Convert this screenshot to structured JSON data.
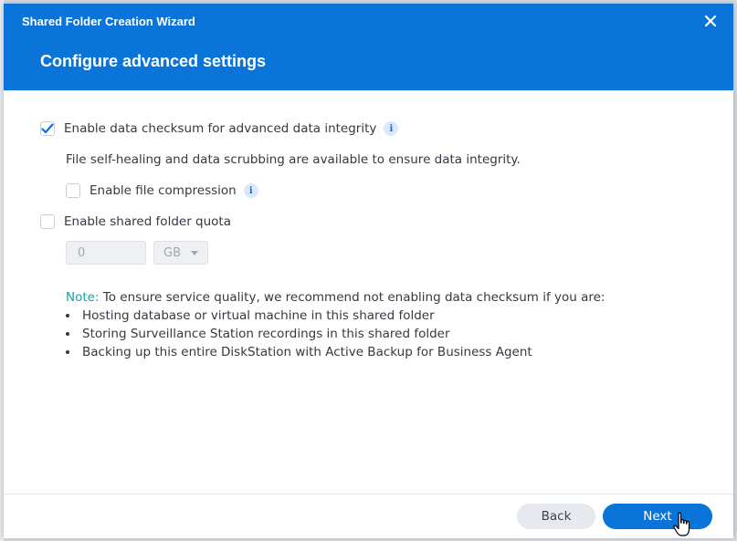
{
  "window": {
    "title": "Shared Folder Creation Wizard"
  },
  "page": {
    "title": "Configure advanced settings"
  },
  "options": {
    "checksum": {
      "label": "Enable data checksum for advanced data integrity",
      "checked": true
    },
    "checksum_description": "File self-healing and data scrubbing are available to ensure data integrity.",
    "compression": {
      "label": "Enable file compression",
      "checked": false
    },
    "quota": {
      "label": "Enable shared folder quota",
      "checked": false,
      "value": "0",
      "unit": "GB"
    }
  },
  "note": {
    "label": "Note:",
    "text": " To ensure service quality, we recommend not enabling data checksum if you are:",
    "items": [
      "Hosting database or virtual machine in this shared folder",
      "Storing Surveillance Station recordings in this shared folder",
      "Backing up this entire DiskStation with Active Backup for Business Agent"
    ]
  },
  "footer": {
    "back_label": "Back",
    "next_label": "Next"
  },
  "colors": {
    "accent": "#0b74d9",
    "note": "#18a3a4"
  }
}
